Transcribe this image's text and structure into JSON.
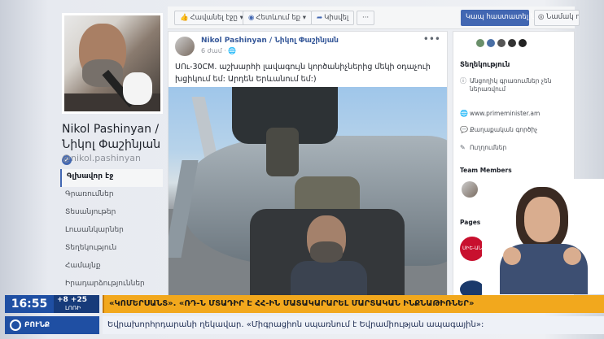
{
  "profile": {
    "name": "Nikol Pashinyan / Նիկոլ Փաշինյան",
    "handle": "@nikol.pashinyan",
    "verified_mark": "✔",
    "nav": [
      "Գլխավոր էջ",
      "Գրառումներ",
      "Տեսանյութեր",
      "Լուսանկարներ",
      "Տեղեկություն",
      "Համայնք",
      "Իրադարձություններ"
    ]
  },
  "toolbar": {
    "like": "Հավանել էջը",
    "follow": "Հետևում եք",
    "share": "Կիսվել",
    "more": "···",
    "contact": "Կապ հաստատել Նիկոլի հետ",
    "send": "Նամակ ուղարկել"
  },
  "post": {
    "author": "Nikol Pashinyan / Նիկոլ Փաշինյան",
    "time": "6 ժամ",
    "text": "ՍՈւ-30СМ. աշխարհի լավագույն կործանիչներից մեկի օդաչուի խցիկում եմ: Արդեն Երևանում եմ:)"
  },
  "sidebar": {
    "about_title": "Տեղեկություն",
    "about_items": [
      {
        "icon": "info-icon",
        "text": "Անցողիկ գրառումներ չեն ներառվում"
      },
      {
        "icon": "globe-icon",
        "text": "www.primeminister.am"
      },
      {
        "icon": "chat-icon",
        "text": "Քաղաքական գործիչ"
      },
      {
        "icon": "edit-icon",
        "text": "Ուղղումներ"
      }
    ],
    "team_title": "Team Members",
    "pages_title": "Pages Liked by This Page",
    "page_logo_text": "ՍԻԵ-ԱՆ",
    "dot_colors": [
      "#6a8f6a",
      "#4a6fa5",
      "#555555",
      "#333333",
      "#222222"
    ]
  },
  "broadcast": {
    "time": "16:55",
    "temps": "+8  +25",
    "city": "ԼՈՌԻ",
    "headline": "«ԿՈՄԵՐՍԱՆՏ». «ՌԴ-Ն ՄՏԱԴԻՐ Է ՀՀ-ԻՆ ՄԱՏԱԿԱՐԱՐԵԼ ՄԱՐՏԱԿԱՆ ԻՆՔՆԱԹԻՌՆԵՐ»",
    "channel": "ԲՈՒՆՔ",
    "ticker": "Եվրախորհրդարանի ղեկավար. «Միգրացիոն սպառնում է Եվրամիության ապագային»:"
  }
}
